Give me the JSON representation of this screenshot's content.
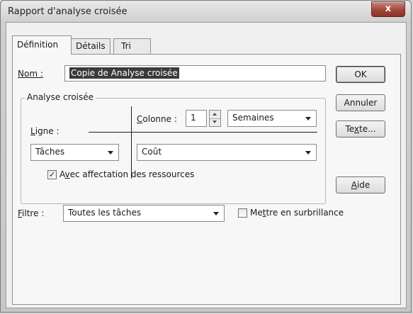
{
  "window": {
    "title": "Rapport d'analyse croisée",
    "close_glyph": "x"
  },
  "tabs": [
    {
      "label": "Définition",
      "active": true
    },
    {
      "label": "Détails",
      "active": false
    },
    {
      "label": "Tri",
      "active": false
    }
  ],
  "name_field": {
    "label": "Nom :",
    "value": "Copie de Analyse croisée"
  },
  "crosstab": {
    "group_label": "Analyse croisée",
    "column_label_underlined": "C",
    "column_label_rest": "olonne :",
    "column_count": "1",
    "column_unit": "Semaines",
    "row_label_underlined": "L",
    "row_label_rest": "igne :",
    "row_value": "Tâches",
    "field_value": "Coût",
    "assignments_checkbox": {
      "pre": "A",
      "underlined": "v",
      "post": "ec affectation des ressources",
      "checked": true,
      "glyph": "✓"
    }
  },
  "filter": {
    "label_underlined": "F",
    "label_rest": "iltre :",
    "value": "Toutes les tâches",
    "highlight_checkbox": {
      "pre": "Me",
      "underlined": "t",
      "post": "tre en surbrillance",
      "checked": false
    }
  },
  "buttons": {
    "ok": "OK",
    "cancel": "Annuler",
    "text_pre": "Te",
    "text_underlined": "x",
    "text_post": "te...",
    "help_underlined": "A",
    "help_rest": "ide"
  }
}
